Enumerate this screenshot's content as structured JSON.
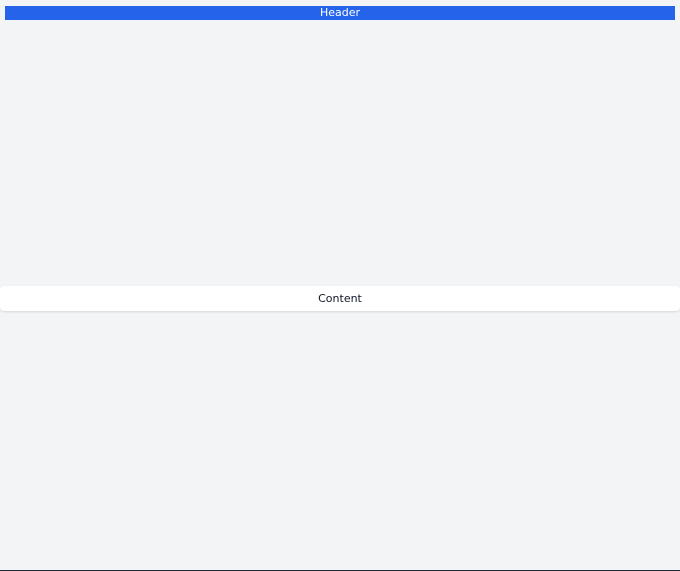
{
  "header": {
    "label": "Header",
    "color": "#2563eb"
  },
  "content": {
    "label": "Content"
  },
  "colors": {
    "background": "#f3f4f6",
    "card": "#ffffff"
  }
}
